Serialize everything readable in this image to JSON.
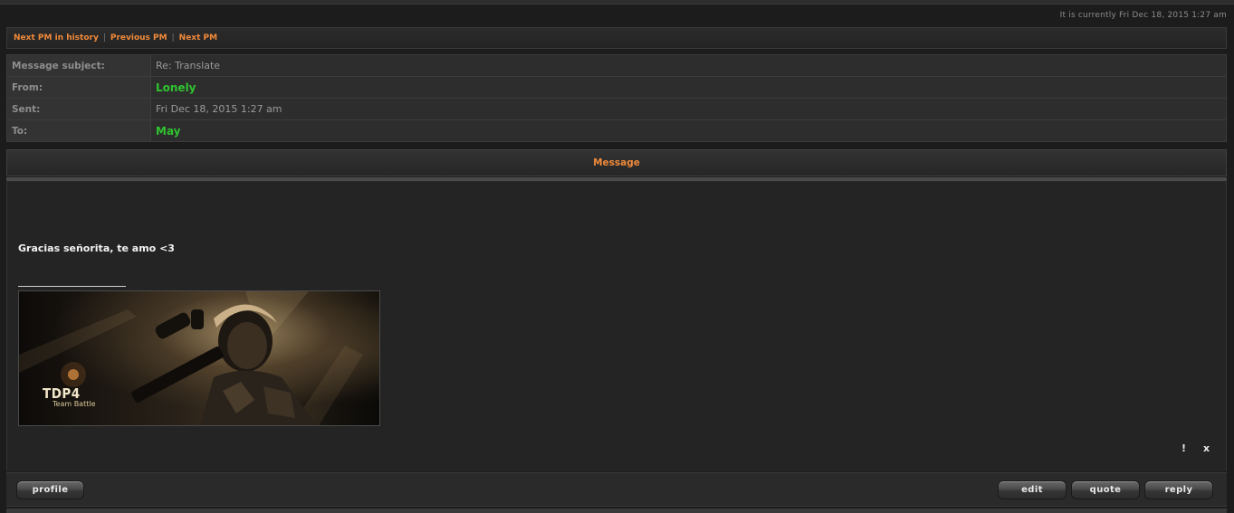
{
  "header": {
    "current_time": "It is currently Fri Dec 18, 2015 1:27 am"
  },
  "nav": {
    "links": [
      "Next PM in history",
      "Previous PM",
      "Next PM"
    ],
    "separator": "|"
  },
  "details": {
    "rows": [
      {
        "label": "Message subject:",
        "value": "Re: Translate"
      },
      {
        "label": "From:",
        "value": "Lonely"
      },
      {
        "label": "Sent:",
        "value": "Fri Dec 18, 2015 1:27 am"
      },
      {
        "label": "To:",
        "value": "May"
      }
    ]
  },
  "message": {
    "header": "Message",
    "text": "Gracias señorita, te amo <3",
    "signature": {
      "title": "TDP4",
      "subtitle": "Team Battle"
    },
    "icons": {
      "report": "!",
      "delete": "x"
    }
  },
  "buttons": {
    "profile": "profile",
    "edit": "edit",
    "quote": "quote",
    "reply": "reply"
  },
  "colors": {
    "accent": "#f08a3a",
    "username": "#2fc42f",
    "background": "#1c1c1c"
  }
}
